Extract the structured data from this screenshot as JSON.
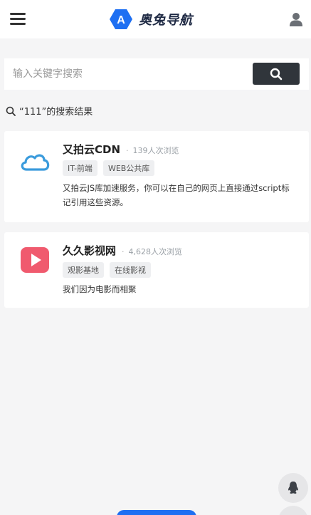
{
  "header": {
    "brand": "奥兔导航",
    "logo_letter": "A",
    "brand_color": "#1e6ff2",
    "icons": {
      "menu": "hamburger-menu-icon",
      "user": "user-icon"
    }
  },
  "search": {
    "placeholder": "输入关键字搜索",
    "value": "",
    "button_icon": "search-icon"
  },
  "results": {
    "heading": "“111”的搜索结果",
    "items": [
      {
        "title": "又拍云CDN",
        "separator": "·",
        "views": "139人次浏览",
        "tags": [
          "IT-前端",
          "WEB公共库"
        ],
        "description": "又拍云JS库加速服务，你可以在自己的网页上直接通过script标记引用这些资源。",
        "icon": "cloud-icon",
        "icon_color": "#3a9bdc"
      },
      {
        "title": "久久影视网",
        "separator": "·",
        "views": "4,628人次浏览",
        "tags": [
          "观影基地",
          "在线影视"
        ],
        "description": "我们因为电影而相聚",
        "icon": "play-icon",
        "icon_color": "#f05a6e"
      }
    ]
  },
  "floating": {
    "top_icon": "qq-penguin-icon",
    "bottom_icon": "wechat-icon"
  }
}
